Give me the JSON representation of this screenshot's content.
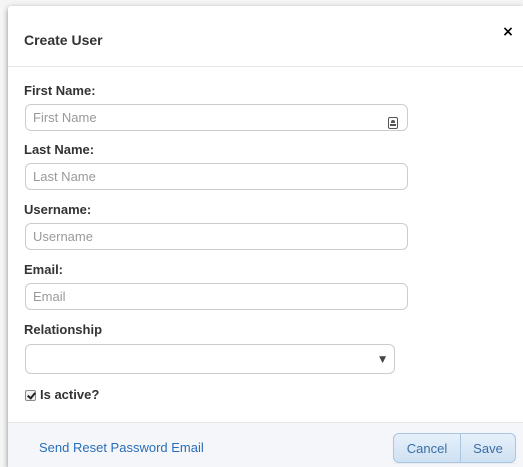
{
  "dialog": {
    "title": "Create User",
    "close_label": "×"
  },
  "form": {
    "first_name": {
      "label": "First Name:",
      "value": "",
      "placeholder": "First Name"
    },
    "last_name": {
      "label": "Last Name:",
      "value": "",
      "placeholder": "Last Name"
    },
    "username": {
      "label": "Username:",
      "value": "",
      "placeholder": "Username"
    },
    "email": {
      "label": "Email:",
      "value": "",
      "placeholder": "Email"
    },
    "relationship": {
      "label": "Relationship",
      "selected": "",
      "arrow": "▼"
    },
    "is_active": {
      "label": "Is active?",
      "checked": true
    }
  },
  "footer": {
    "reset_link": "Send Reset Password Email",
    "cancel_label": "Cancel",
    "save_label": "Save"
  },
  "icons": {
    "autofill": "contact-card-icon"
  },
  "colors": {
    "link": "#2a6eb8",
    "button_text": "#3a6ea5",
    "button_border": "#a9c6e2",
    "footer_bg": "#f4f6f9"
  }
}
